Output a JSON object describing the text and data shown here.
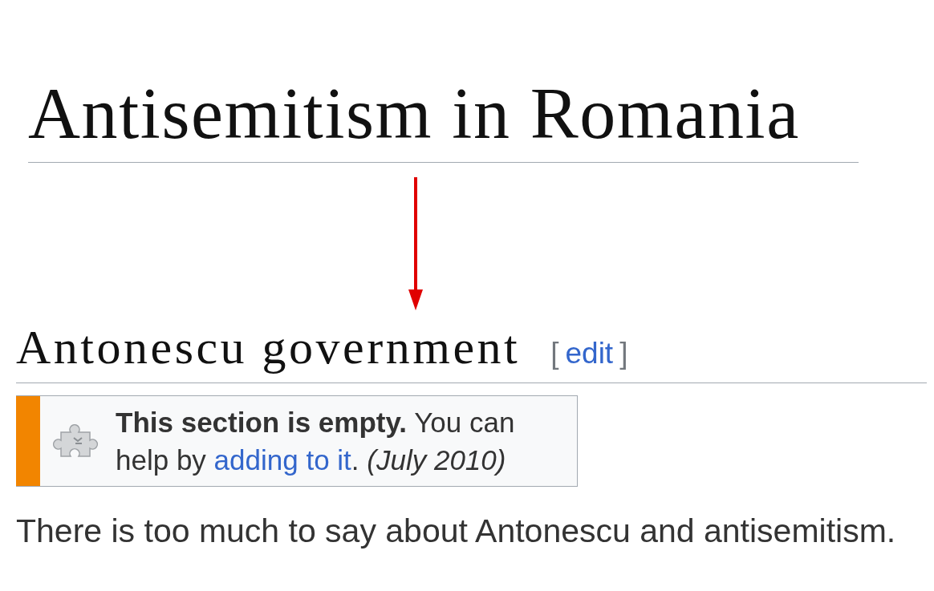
{
  "page_title": "Antisemitism in Romania",
  "section": {
    "heading": "Antonescu government",
    "edit": {
      "open_bracket": "[",
      "label": "edit",
      "close_bracket": "]"
    }
  },
  "notice": {
    "before": "**This section is empty.** You can help by ",
    "link": "adding to it",
    "after": ". *(July 2010)*"
  },
  "paragraph": "There is too much to say about Antonescu and antisemitism."
}
